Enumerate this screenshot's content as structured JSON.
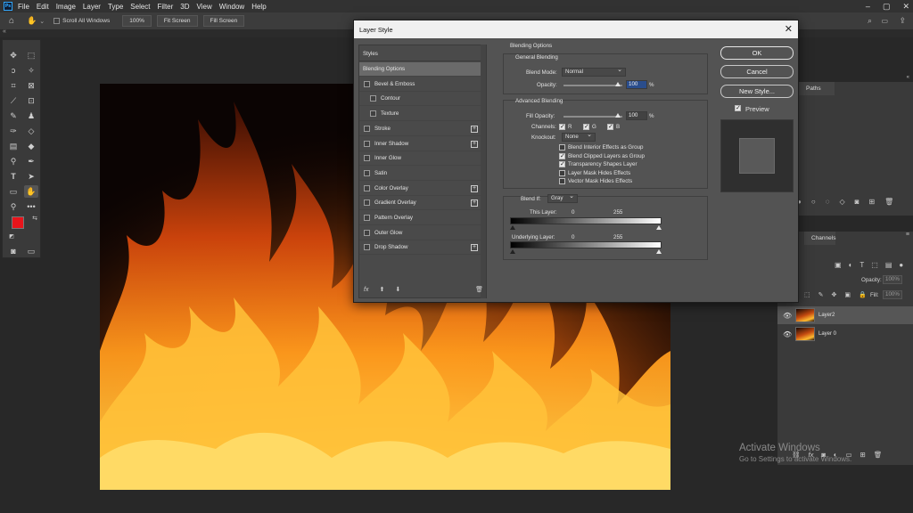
{
  "menu": [
    "File",
    "Edit",
    "Image",
    "Layer",
    "Type",
    "Select",
    "Filter",
    "3D",
    "View",
    "Window",
    "Help"
  ],
  "options_bar": {
    "scroll_all": "Scroll All Windows",
    "zoom_100": "100%",
    "fit_screen": "Fit Screen",
    "fill_screen": "Fill Screen"
  },
  "dialog": {
    "title": "Layer Style",
    "styles_header": "Styles",
    "styles": [
      {
        "label": "Blending Options",
        "checkbox": false,
        "selected": true,
        "plus": false,
        "indent": false
      },
      {
        "label": "Bevel & Emboss",
        "checkbox": true,
        "selected": false,
        "plus": false,
        "indent": false
      },
      {
        "label": "Contour",
        "checkbox": true,
        "selected": false,
        "plus": false,
        "indent": true
      },
      {
        "label": "Texture",
        "checkbox": true,
        "selected": false,
        "plus": false,
        "indent": true
      },
      {
        "label": "Stroke",
        "checkbox": true,
        "selected": false,
        "plus": true,
        "indent": false
      },
      {
        "label": "Inner Shadow",
        "checkbox": true,
        "selected": false,
        "plus": true,
        "indent": false
      },
      {
        "label": "Inner Glow",
        "checkbox": true,
        "selected": false,
        "plus": false,
        "indent": false
      },
      {
        "label": "Satin",
        "checkbox": true,
        "selected": false,
        "plus": false,
        "indent": false
      },
      {
        "label": "Color Overlay",
        "checkbox": true,
        "selected": false,
        "plus": true,
        "indent": false
      },
      {
        "label": "Gradient Overlay",
        "checkbox": true,
        "selected": false,
        "plus": true,
        "indent": false
      },
      {
        "label": "Pattern Overlay",
        "checkbox": true,
        "selected": false,
        "plus": false,
        "indent": false
      },
      {
        "label": "Outer Glow",
        "checkbox": true,
        "selected": false,
        "plus": false,
        "indent": false
      },
      {
        "label": "Drop Shadow",
        "checkbox": true,
        "selected": false,
        "plus": true,
        "indent": false
      }
    ],
    "fx_label": "fx",
    "blending_options_title": "Blending Options",
    "general_blending": "General Blending",
    "blend_mode_label": "Blend Mode:",
    "blend_mode_value": "Normal",
    "opacity_label": "Opacity:",
    "opacity_value": "100",
    "percent": "%",
    "advanced_blending": "Advanced Blending",
    "fill_opacity_label": "Fill Opacity:",
    "fill_opacity_value": "100",
    "channels_label": "Channels:",
    "channel_r": "R",
    "channel_g": "G",
    "channel_b": "B",
    "knockout_label": "Knockout:",
    "knockout_value": "None",
    "checks": [
      {
        "label": "Blend Interior Effects as Group",
        "checked": false
      },
      {
        "label": "Blend Clipped Layers as Group",
        "checked": true
      },
      {
        "label": "Transparency Shapes Layer",
        "checked": true
      },
      {
        "label": "Layer Mask Hides Effects",
        "checked": false
      },
      {
        "label": "Vector Mask Hides Effects",
        "checked": false
      }
    ],
    "blend_if_label": "Blend If:",
    "blend_if_value": "Gray",
    "this_layer_label": "This Layer:",
    "underlying_label": "Underlying Layer:",
    "range_min": "0",
    "range_max": "255",
    "ok": "OK",
    "cancel": "Cancel",
    "new_style": "New Style...",
    "preview": "Preview"
  },
  "panels": {
    "paths_tab": "Paths",
    "channels_tab": "Channels",
    "opacity_label": "Opacity:",
    "opacity_value": "100%",
    "fill_label": "Fill:",
    "fill_value": "100%",
    "layers": [
      {
        "name": "Layer2",
        "selected": true
      },
      {
        "name": "Layer 0",
        "selected": false
      }
    ]
  },
  "watermark": {
    "line1": "Activate Windows",
    "line2": "Go to Settings to activate Windows."
  },
  "colors": {
    "foreground": "#e8141b",
    "background": "#ffffff",
    "accent": "#31a8ff"
  }
}
